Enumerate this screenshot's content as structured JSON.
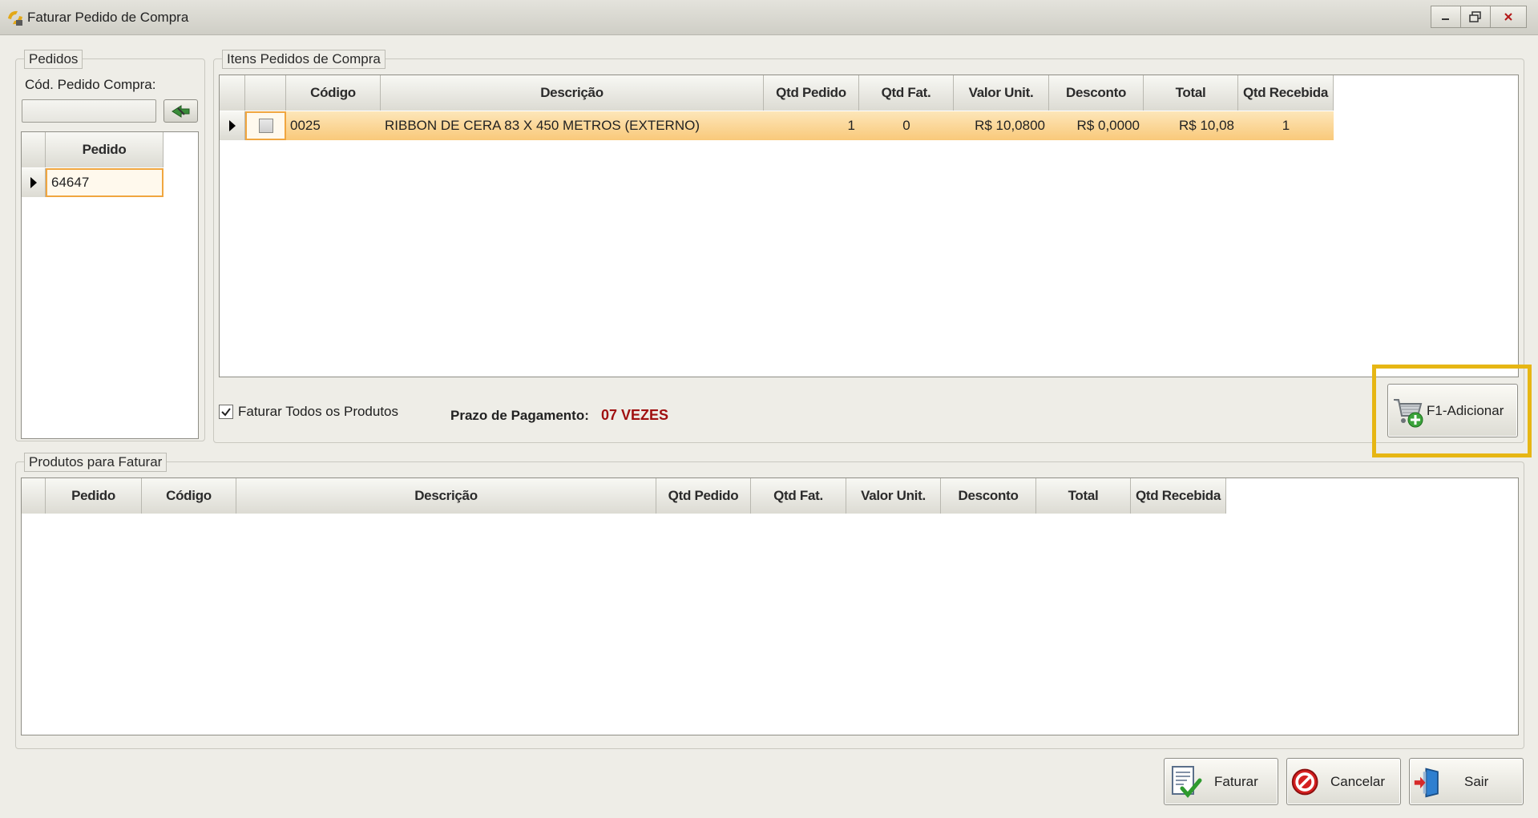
{
  "window": {
    "title": "Faturar Pedido de Compra",
    "controls": [
      "minimize",
      "restore",
      "close"
    ]
  },
  "pedidos": {
    "legend": "Pedidos",
    "cod_label": "Cód. Pedido Compra:",
    "cod_value": "",
    "grid": {
      "header": "Pedido",
      "rows": [
        "64647"
      ]
    }
  },
  "itens": {
    "legend": "Itens Pedidos de Compra",
    "columns": [
      "Código",
      "Descrição",
      "Qtd Pedido",
      "Qtd Fat.",
      "Valor Unit.",
      "Desconto",
      "Total",
      "Qtd Recebida"
    ],
    "rows": [
      {
        "codigo": "0025",
        "descricao": "RIBBON DE CERA 83 X 450 METROS (EXTERNO)",
        "qtd_pedido": "1",
        "qtd_fat": "0",
        "valor_unit": "R$ 10,0800",
        "desconto": "R$ 0,0000",
        "total": "R$ 10,08",
        "qtd_recebida": "1"
      }
    ],
    "faturar_todos_label": "Faturar Todos os Produtos",
    "faturar_todos_checked": true,
    "prazo_label": "Prazo de Pagamento:",
    "prazo_value": "07 VEZES",
    "adicionar_label": "F1-Adicionar"
  },
  "produtos": {
    "legend": "Produtos para Faturar",
    "columns": [
      "Pedido",
      "Código",
      "Descrição",
      "Qtd Pedido",
      "Qtd Fat.",
      "Valor Unit.",
      "Desconto",
      "Total",
      "Qtd Recebida"
    ]
  },
  "footer": {
    "faturar_label": "Faturar",
    "cancelar_label": "Cancelar",
    "sair_label": "Sair"
  },
  "colors": {
    "selected_row": "#f9c97a",
    "highlight": "#e6b614",
    "prazo_value": "#a01010"
  }
}
